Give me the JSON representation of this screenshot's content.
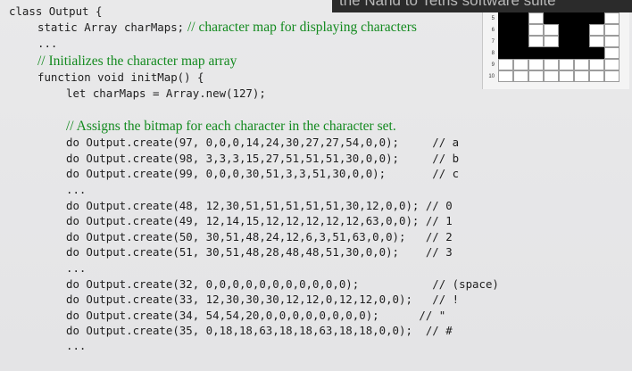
{
  "code_lines": [
    {
      "indent": 0,
      "code": "class Output {",
      "comment": "",
      "pad": 0
    },
    {
      "indent": 1,
      "code": "static Array charMaps;",
      "comment": "// character map for displaying characters",
      "pad": 1
    },
    {
      "indent": 1,
      "code": "...",
      "comment": "",
      "pad": 0
    },
    {
      "indent": 1,
      "code": "",
      "comment": "// Initializes the character map array",
      "pad": 0
    },
    {
      "indent": 1,
      "code": "function void initMap() {",
      "comment": "",
      "pad": 0
    },
    {
      "indent": 2,
      "code": "let charMaps = Array.new(127);",
      "comment": "",
      "pad": 0
    },
    {
      "indent": 0,
      "code": "",
      "comment": "",
      "pad": 0
    },
    {
      "indent": 2,
      "code": "",
      "comment": "// Assigns the bitmap for each character in the character set.",
      "pad": 0
    },
    {
      "indent": 2,
      "code": "do Output.create(97, 0,0,0,14,24,30,27,27,54,0,0);",
      "code_comment": "// a",
      "pad": 5
    },
    {
      "indent": 2,
      "code": "do Output.create(98, 3,3,3,15,27,51,51,51,30,0,0);",
      "code_comment": "// b",
      "pad": 5
    },
    {
      "indent": 2,
      "code": "do Output.create(99, 0,0,0,30,51,3,3,51,30,0,0);",
      "code_comment": "// c",
      "pad": 7
    },
    {
      "indent": 2,
      "code": "...",
      "comment": "",
      "pad": 0
    },
    {
      "indent": 2,
      "code": "do Output.create(48, 12,30,51,51,51,51,51,30,12,0,0);",
      "code_comment": "// 0",
      "pad": 1
    },
    {
      "indent": 2,
      "code": "do Output.create(49, 12,14,15,12,12,12,12,12,63,0,0);",
      "code_comment": "// 1",
      "pad": 1
    },
    {
      "indent": 2,
      "code": "do Output.create(50, 30,51,48,24,12,6,3,51,63,0,0);",
      "code_comment": "// 2",
      "pad": 3
    },
    {
      "indent": 2,
      "code": "do Output.create(51, 30,51,48,28,48,48,51,30,0,0);",
      "code_comment": "// 3",
      "pad": 4
    },
    {
      "indent": 2,
      "code": "...",
      "comment": "",
      "pad": 0
    },
    {
      "indent": 2,
      "code": "do Output.create(32, 0,0,0,0,0,0,0,0,0,0,0);",
      "code_comment": "// (space)",
      "pad": 11
    },
    {
      "indent": 2,
      "code": "do Output.create(33, 12,30,30,30,12,12,0,12,12,0,0);",
      "code_comment": "// !",
      "pad": 3
    },
    {
      "indent": 2,
      "code": "do Output.create(34, 54,54,20,0,0,0,0,0,0,0,0);",
      "code_comment": "// \"",
      "pad": 6
    },
    {
      "indent": 2,
      "code": "do Output.create(35, 0,18,18,63,18,18,63,18,18,0,0);",
      "code_comment": "// #",
      "pad": 2
    },
    {
      "indent": 2,
      "code": "...",
      "comment": "",
      "pad": 0
    }
  ],
  "caption": {
    "text": "the Nand to Tetris software suite"
  },
  "bitmap": {
    "row_labels": [
      "5",
      "6",
      "7",
      "8",
      "9",
      "10"
    ],
    "first_row_label_visible": "5",
    "rows": [
      [
        1,
        1,
        0,
        1,
        1,
        1,
        1,
        0
      ],
      [
        1,
        1,
        0,
        0,
        1,
        1,
        0,
        0
      ],
      [
        1,
        1,
        0,
        0,
        1,
        1,
        0,
        0
      ],
      [
        1,
        1,
        1,
        1,
        1,
        1,
        1,
        0
      ],
      [
        0,
        0,
        0,
        0,
        0,
        0,
        0,
        0
      ],
      [
        0,
        0,
        0,
        0,
        0,
        0,
        0,
        0
      ]
    ]
  },
  "colors": {
    "comment": "#138a1f",
    "code": "#1e1e1e",
    "grid_on": "#000000",
    "grid_off": "#ffffff"
  }
}
